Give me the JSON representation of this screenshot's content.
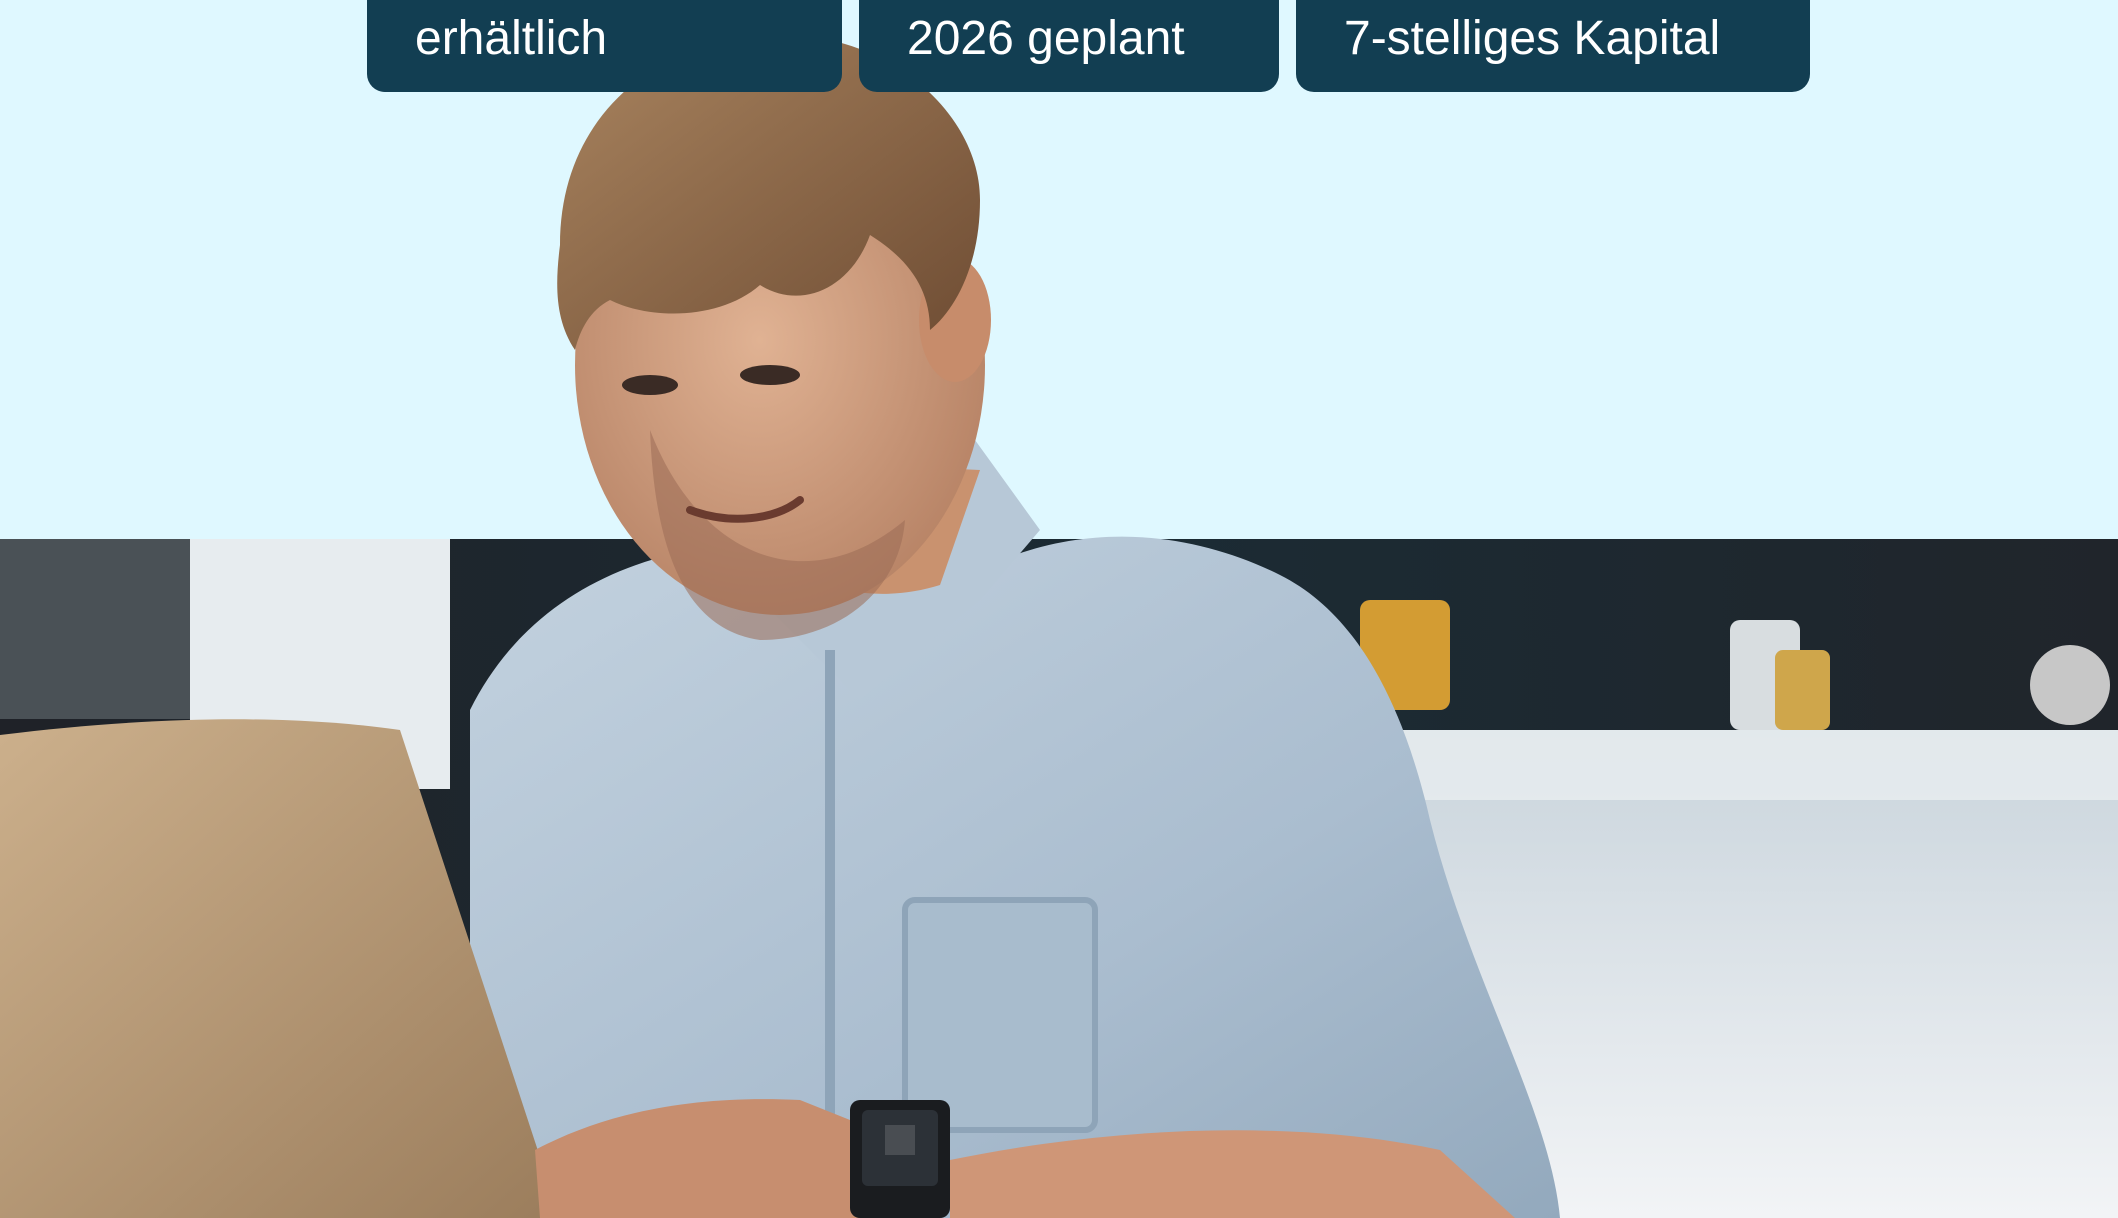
{
  "feature_cards": [
    {
      "text": "erhältlich"
    },
    {
      "text": "2026 geplant"
    },
    {
      "text": "7-stelliges Kapital"
    }
  ],
  "hero": {
    "photo_icon": "person-at-laptop-photo"
  }
}
